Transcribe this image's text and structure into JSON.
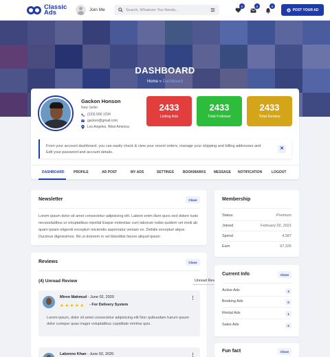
{
  "header": {
    "logo_text_1": "Classic",
    "logo_text_2": "Ads",
    "join_label": "Join Me",
    "search_placeholder": "Search, Whatever You Needs...",
    "badges": {
      "favorites": "0",
      "messages": "0",
      "notifications": "0"
    },
    "post_ad_label": "POST YOUR AD",
    "accent_color": "#1f3ba8"
  },
  "hero": {
    "title": "DASHBOARD",
    "breadcrumb_home": "Home",
    "breadcrumb_sep": "»",
    "breadcrumb_current": "Dashboard"
  },
  "profile": {
    "name": "Gackon Honson",
    "role": "New Seller",
    "phone": "(123) 000 1234",
    "email": "gackon@gmail.com",
    "location": "Los Angeles, West America"
  },
  "stats": [
    {
      "value": "2433",
      "label": "Listing Ads",
      "color": "#e33e3e"
    },
    {
      "value": "2433",
      "label": "Total Follower",
      "color": "#2ebc3c"
    },
    {
      "value": "2433",
      "label": "Total Review",
      "color": "#d5a519"
    }
  ],
  "notice": {
    "text": "From your account dashboard. you can easily check & view your recent orders, manage your shipping and billing addresses and Edit your password and account details.",
    "close_glyph": "✕"
  },
  "tabs": [
    "DASHBOARD",
    "PROFILE",
    "AD POST",
    "MY ADS",
    "SETTINGS",
    "BOOKMARKS",
    "MESSAGE",
    "NOTIFICATION",
    "LOGOUT"
  ],
  "newsletter": {
    "title": "Newsletter",
    "close_label": "Close",
    "text": "Lorem ipsum dolor sit amet consectetur adipisicing elit. Labore enim illum quos sed dolore iusto necessitatibus ut voluptatibus repellat Eaque molestiae cum laborum nobis quidem vel modi ab quam ipsam eligendi excepturi reiciendis aspernatur veniam ex. Debitis excepturi atque. Ducimus dignissimos. Illo ut dolorem in vel blanditiis facere aliquid ipsum"
  },
  "reviews": {
    "title": "Reviews",
    "close_label": "Close",
    "unread_heading": "(4) Unread Review",
    "select_value": "Unread Review",
    "items": [
      {
        "name": "Miron Mahmud",
        "date": "June 02, 2020",
        "stars": "★★★★★",
        "label": "- For Delivery System",
        "text": "Lorem ipsum, dolor sit amet consectetur adipisicing elit Non quibusdam harum ipsum dolor cumque quas magni voluptatibus cupiditate minima quis."
      },
      {
        "name": "Labonno Khan",
        "date": "June 02, 2020"
      }
    ]
  },
  "membership": {
    "title": "Membership",
    "rows": [
      {
        "label": "Status",
        "value": "Premium"
      },
      {
        "label": "Joined",
        "value": "February 02, 2021"
      },
      {
        "label": "Spend",
        "value": "4,587"
      },
      {
        "label": "Earn",
        "value": "97,325"
      }
    ]
  },
  "current_info": {
    "title": "Current Info",
    "close_label": "Close",
    "rows": [
      {
        "label": "Active Ads",
        "value": "3"
      },
      {
        "label": "Booking Ads",
        "value": "0"
      },
      {
        "label": "Rental Ads",
        "value": "1"
      },
      {
        "label": "Sales Ads",
        "value": "2"
      }
    ]
  },
  "fun_fact": {
    "title": "Fun fact",
    "close_label": "Close"
  }
}
